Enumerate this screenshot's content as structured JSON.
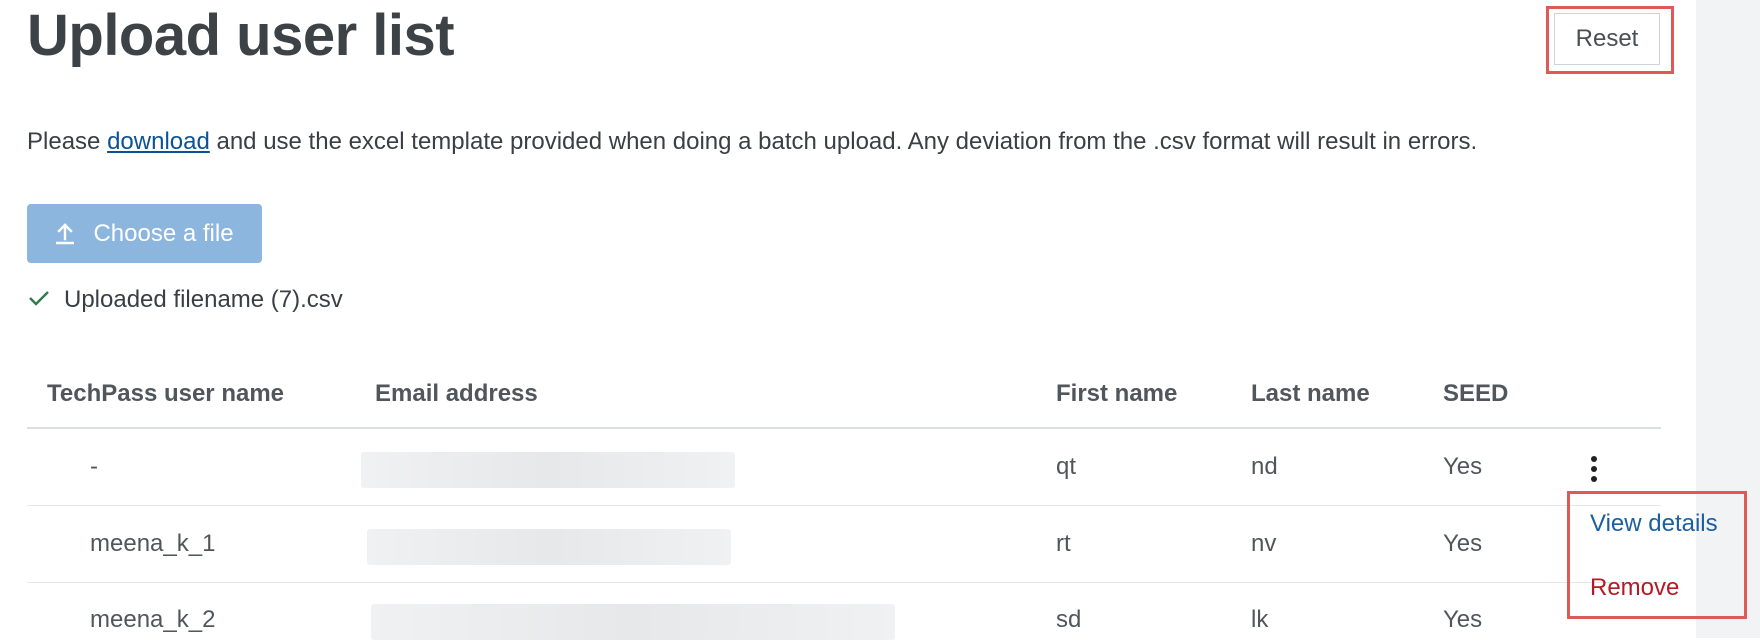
{
  "page": {
    "title": "Upload user list",
    "reset_label": "Reset",
    "instructions": {
      "before": "Please ",
      "link": "download",
      "after": " and use the excel template provided when doing a batch upload. Any deviation from the .csv format will result in errors."
    },
    "choose_file_label": "Choose a file",
    "uploaded_text": "Uploaded filename (7).csv"
  },
  "table": {
    "headers": [
      "TechPass user name",
      "Email address",
      "First name",
      "Last name",
      "SEED"
    ],
    "rows": [
      {
        "username": "-",
        "first": "qt",
        "last": "nd",
        "seed": "Yes"
      },
      {
        "username": "meena_k_1",
        "first": "rt",
        "last": "nv",
        "seed": "Yes"
      },
      {
        "username": "meena_k_2",
        "first": "sd",
        "last": "lk",
        "seed": "Yes"
      }
    ]
  },
  "row_menu": {
    "view_details": "View details",
    "remove": "Remove"
  },
  "colors": {
    "highlight": "#e05a55",
    "link": "#0b5394",
    "primary_button": "#8cb6de",
    "success_check": "#2e7d4f",
    "danger": "#b21a26"
  },
  "icons": [
    "upload-icon",
    "check-icon",
    "kebab-menu-icon"
  ]
}
